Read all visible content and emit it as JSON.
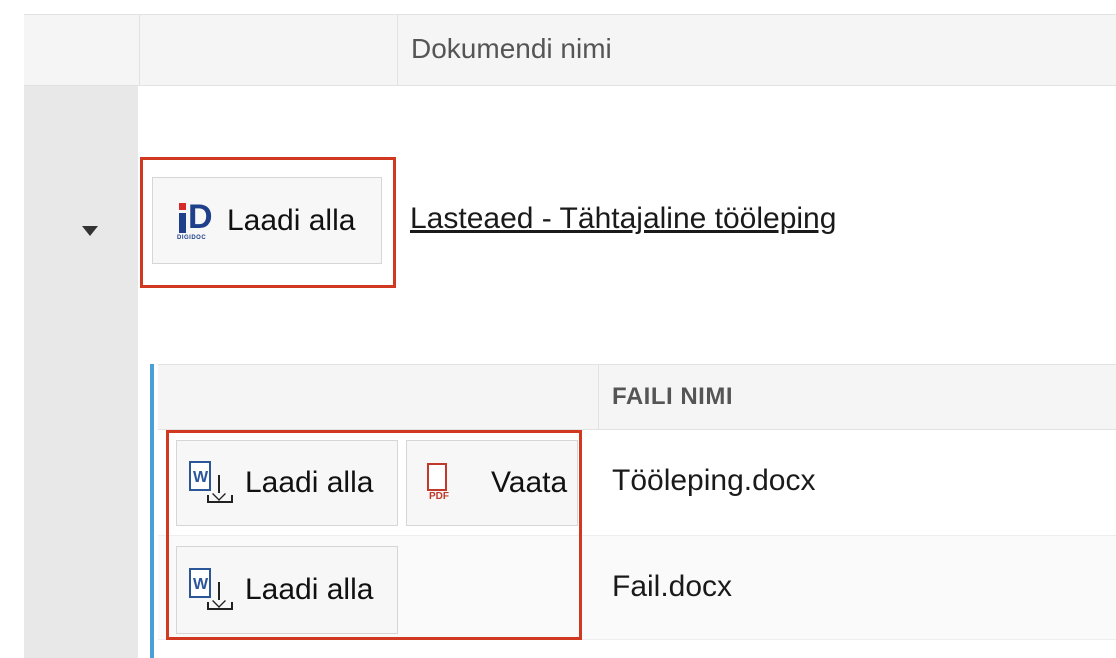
{
  "table": {
    "header": {
      "document_name": "Dokumendi nimi"
    }
  },
  "document": {
    "download_label": "Laadi alla",
    "digidoc_logo_text": "DIGIDOC",
    "title": "Lasteaed - Tähtajaline tööleping"
  },
  "files": {
    "header": {
      "file_name": "FAILI NIMI"
    },
    "rows": [
      {
        "download_label": "Laadi alla",
        "view_label": "Vaata",
        "file_name": "Tööleping.docx"
      },
      {
        "download_label": "Laadi alla",
        "file_name": "Fail.docx"
      }
    ]
  },
  "icons": {
    "expand": "caret-down-icon",
    "digidoc": "digidoc-logo-icon",
    "word_download": "word-download-icon",
    "pdf": "pdf-icon"
  },
  "colors": {
    "highlight": "#d0391f",
    "accent_border": "#4a9fd8",
    "word_blue": "#2b579a",
    "pdf_red": "#c0392b"
  }
}
